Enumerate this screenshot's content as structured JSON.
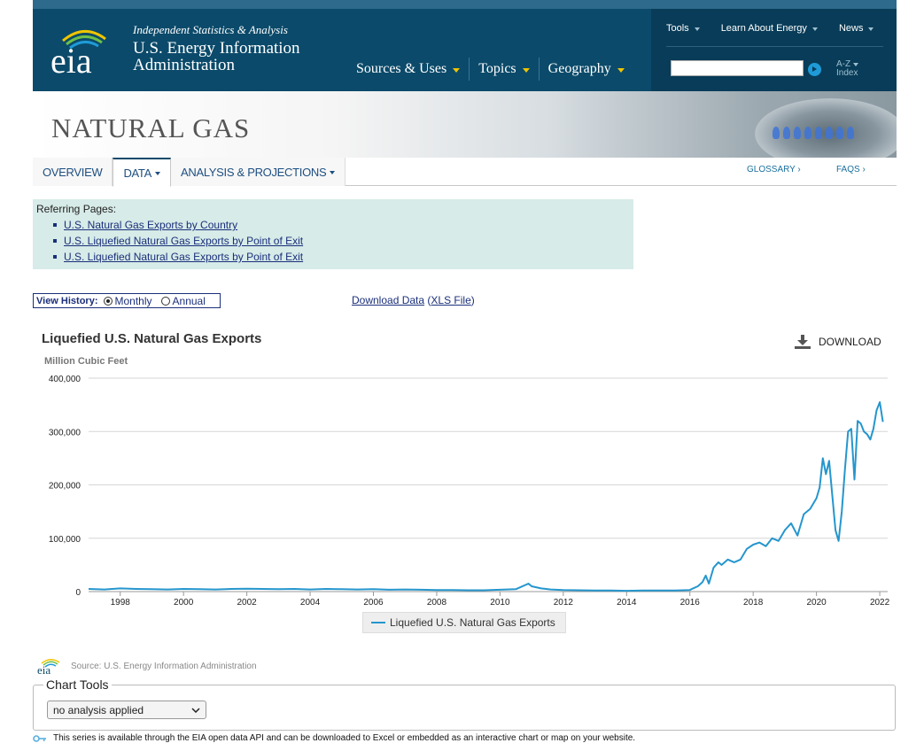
{
  "header": {
    "tagline": "Independent Statistics & Analysis",
    "org_line1": "U.S. Energy Information",
    "org_line2": "Administration",
    "logo_text": "eia",
    "nav": [
      {
        "label": "Sources & Uses"
      },
      {
        "label": "Topics"
      },
      {
        "label": "Geography"
      }
    ],
    "util_nav": [
      {
        "label": "Tools"
      },
      {
        "label": "Learn About Energy"
      },
      {
        "label": "News"
      }
    ],
    "search_value": "",
    "az_line1": "A-Z",
    "az_line2": "Index"
  },
  "banner": {
    "title": "NATURAL GAS"
  },
  "tabs": {
    "items": [
      {
        "label": "OVERVIEW"
      },
      {
        "label": "DATA"
      },
      {
        "label": "ANALYSIS & PROJECTIONS"
      }
    ],
    "active": "DATA",
    "glossary": "GLOSSARY ›",
    "faqs": "FAQS ›"
  },
  "referring": {
    "heading": "Referring Pages:",
    "links": [
      "U.S. Natural Gas Exports by Country",
      "U.S. Liquefied Natural Gas Exports by Point of Exit",
      "U.S. Liquefied Natural Gas Exports by Point of Exit"
    ]
  },
  "view_history": {
    "label": "View History:",
    "options": [
      "Monthly",
      "Annual"
    ],
    "selected": "Monthly"
  },
  "download_data": {
    "text": "Download Data",
    "file_type": "XLS File"
  },
  "chart": {
    "download_label": "DOWNLOAD"
  },
  "chart_data": {
    "type": "line",
    "title": "Liquefied U.S. Natural Gas Exports",
    "ylabel": "Million Cubic Feet",
    "xlabel": "",
    "ylim": [
      0,
      400000
    ],
    "y_ticks": [
      "0",
      "100,000",
      "200,000",
      "300,000",
      "400,000"
    ],
    "x_ticks": [
      "1998",
      "2000",
      "2002",
      "2004",
      "2006",
      "2008",
      "2010",
      "2012",
      "2014",
      "2016",
      "2018",
      "2020",
      "2022"
    ],
    "grid": "horizontal",
    "legend_position": "bottom-center",
    "series": [
      {
        "name": "Liquefied U.S. Natural Gas Exports",
        "color": "#2596cd",
        "x": [
          1997.0,
          1997.5,
          1998.0,
          1998.5,
          1999.0,
          1999.5,
          2000.0,
          2000.5,
          2001.0,
          2001.5,
          2002.0,
          2002.5,
          2003.0,
          2003.5,
          2004.0,
          2004.5,
          2005.0,
          2005.5,
          2006.0,
          2006.5,
          2007.0,
          2007.5,
          2008.0,
          2008.5,
          2009.0,
          2009.5,
          2010.0,
          2010.5,
          2010.9,
          2011.0,
          2011.3,
          2011.6,
          2012.0,
          2012.5,
          2013.0,
          2013.5,
          2014.0,
          2014.5,
          2015.0,
          2015.5,
          2016.0,
          2016.1,
          2016.25,
          2016.4,
          2016.5,
          2016.6,
          2016.75,
          2016.9,
          2017.0,
          2017.2,
          2017.4,
          2017.6,
          2017.8,
          2018.0,
          2018.2,
          2018.4,
          2018.6,
          2018.8,
          2019.0,
          2019.2,
          2019.4,
          2019.6,
          2019.8,
          2020.0,
          2020.1,
          2020.2,
          2020.3,
          2020.4,
          2020.5,
          2020.6,
          2020.7,
          2020.8,
          2020.9,
          2021.0,
          2021.1,
          2021.2,
          2021.3,
          2021.4,
          2021.5,
          2021.6,
          2021.7,
          2021.8,
          2021.9,
          2022.0,
          2022.1
        ],
        "values": [
          5000,
          4000,
          6000,
          5000,
          4500,
          4000,
          5000,
          4500,
          4000,
          5000,
          5500,
          5000,
          4500,
          5000,
          4000,
          5000,
          4500,
          4000,
          4500,
          3500,
          4000,
          3500,
          3000,
          3000,
          2500,
          2500,
          3500,
          4500,
          15000,
          10000,
          6000,
          4000,
          3000,
          2500,
          2000,
          2000,
          1500,
          2000,
          2000,
          2000,
          3000,
          6000,
          10000,
          18000,
          30000,
          15000,
          45000,
          55000,
          50000,
          60000,
          55000,
          60000,
          80000,
          88000,
          92000,
          85000,
          100000,
          95000,
          115000,
          128000,
          105000,
          145000,
          155000,
          175000,
          195000,
          250000,
          220000,
          245000,
          180000,
          115000,
          95000,
          150000,
          230000,
          300000,
          305000,
          210000,
          320000,
          315000,
          300000,
          295000,
          285000,
          305000,
          340000,
          355000,
          318000
        ]
      }
    ]
  },
  "source": {
    "text": "Source: U.S. Energy Information Administration"
  },
  "chart_tools": {
    "title": "Chart Tools",
    "select_value": "no analysis applied"
  },
  "api_note": "This series is available through the EIA open data API and can be downloaded to Excel or embedded as an interactive chart or map on your website."
}
